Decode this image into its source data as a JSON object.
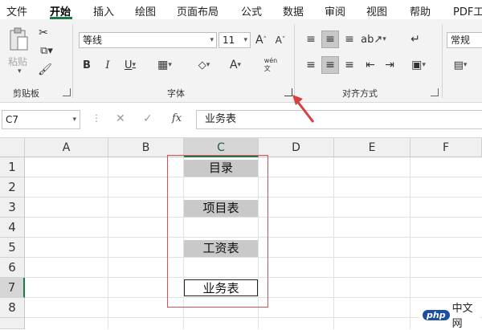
{
  "tabs": [
    "文件",
    "开始",
    "插入",
    "绘图",
    "页面布局",
    "公式",
    "数据",
    "审阅",
    "视图",
    "帮助",
    "PDF工"
  ],
  "ribbon": {
    "clipboard": {
      "paste_label": "粘贴",
      "group_label": "剪贴板"
    },
    "font": {
      "name": "等线",
      "size": "11",
      "group_label": "字体"
    },
    "alignment": {
      "group_label": "对齐方式"
    },
    "number": {
      "format": "常规"
    }
  },
  "formula_bar": {
    "name_box": "C7",
    "fx": "fx",
    "content": "业务表"
  },
  "columns": [
    "A",
    "B",
    "C",
    "D",
    "E",
    "F"
  ],
  "rows": [
    "1",
    "2",
    "3",
    "4",
    "5",
    "6",
    "7",
    "8"
  ],
  "cells": {
    "c1": "目录",
    "c3": "项目表",
    "c5": "工资表",
    "c7": "业务表"
  },
  "watermark": {
    "logo": "php",
    "text": "中文网"
  },
  "colors": {
    "accent": "#1f7a4a",
    "highlight_box": "#d85050",
    "cell_fill": "#c9c9c9"
  }
}
